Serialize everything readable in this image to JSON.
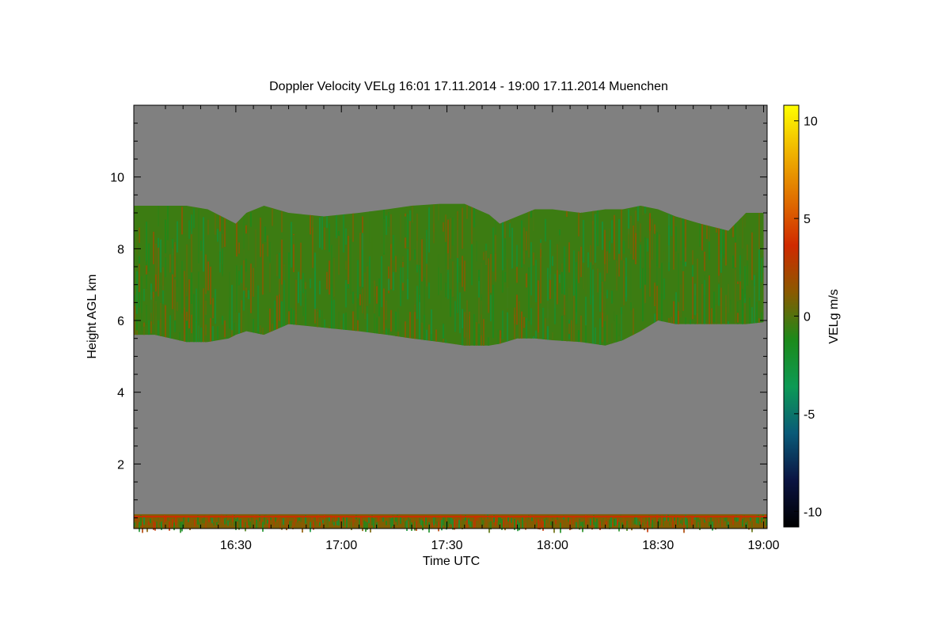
{
  "chart_data": {
    "type": "heatmap",
    "title": "Doppler Velocity VELg   16:01 17.11.2014 - 19:00 17.11.2014 Muenchen",
    "xlabel": "Time UTC",
    "ylabel": "Height AGL km",
    "colorbar_label": "VELg m/s",
    "x_tick_labels": [
      "16:30",
      "17:00",
      "17:30",
      "18:00",
      "18:30",
      "19:00"
    ],
    "x_ticks_minutes": [
      990,
      1020,
      1050,
      1080,
      1110,
      1140
    ],
    "xlim_minutes": [
      961,
      1141
    ],
    "y_tick_labels": [
      "2",
      "4",
      "6",
      "8",
      "10"
    ],
    "y_ticks": [
      2,
      4,
      6,
      8,
      10
    ],
    "ylim": [
      0.2,
      12.0
    ],
    "colorbar_tick_labels": [
      "10",
      "5",
      "0",
      "-5",
      "-10"
    ],
    "colorbar_ticks": [
      10,
      5,
      0,
      -5,
      -10
    ],
    "clim": [
      -10.8,
      10.8
    ],
    "colormap": [
      "#000000",
      "#0b1442",
      "#0a5a78",
      "#0d9a55",
      "#1c8a1a",
      "#8a5a00",
      "#d02a00",
      "#e07000",
      "#f0b400",
      "#ffff00"
    ],
    "background_color": "#808080",
    "grid": false,
    "cloud_layer": {
      "times_minutes": [
        961,
        967,
        976,
        982,
        988,
        990,
        993,
        998,
        1005,
        1015,
        1025,
        1033,
        1040,
        1048,
        1055,
        1062,
        1065,
        1070,
        1075,
        1080,
        1088,
        1095,
        1100,
        1105,
        1110,
        1115,
        1122,
        1130,
        1135,
        1140
      ],
      "top_km": [
        9.2,
        9.2,
        9.2,
        9.1,
        8.8,
        8.7,
        9.0,
        9.2,
        9.0,
        8.9,
        9.0,
        9.1,
        9.2,
        9.25,
        9.25,
        8.95,
        8.7,
        8.9,
        9.1,
        9.1,
        9.0,
        9.1,
        9.1,
        9.2,
        9.1,
        8.9,
        8.7,
        8.5,
        9.0,
        9.0
      ],
      "base_km": [
        5.6,
        5.6,
        5.4,
        5.4,
        5.5,
        5.6,
        5.7,
        5.6,
        5.9,
        5.8,
        5.7,
        5.6,
        5.5,
        5.4,
        5.3,
        5.3,
        5.35,
        5.5,
        5.5,
        5.45,
        5.4,
        5.3,
        5.45,
        5.7,
        6.0,
        5.9,
        5.9,
        5.9,
        5.9,
        5.95
      ],
      "dominant_velocity_ms": -0.5
    },
    "boundary_layer": {
      "top_km": 0.6,
      "base_km": 0.2,
      "dominant_velocity_ms": 1.0
    }
  }
}
